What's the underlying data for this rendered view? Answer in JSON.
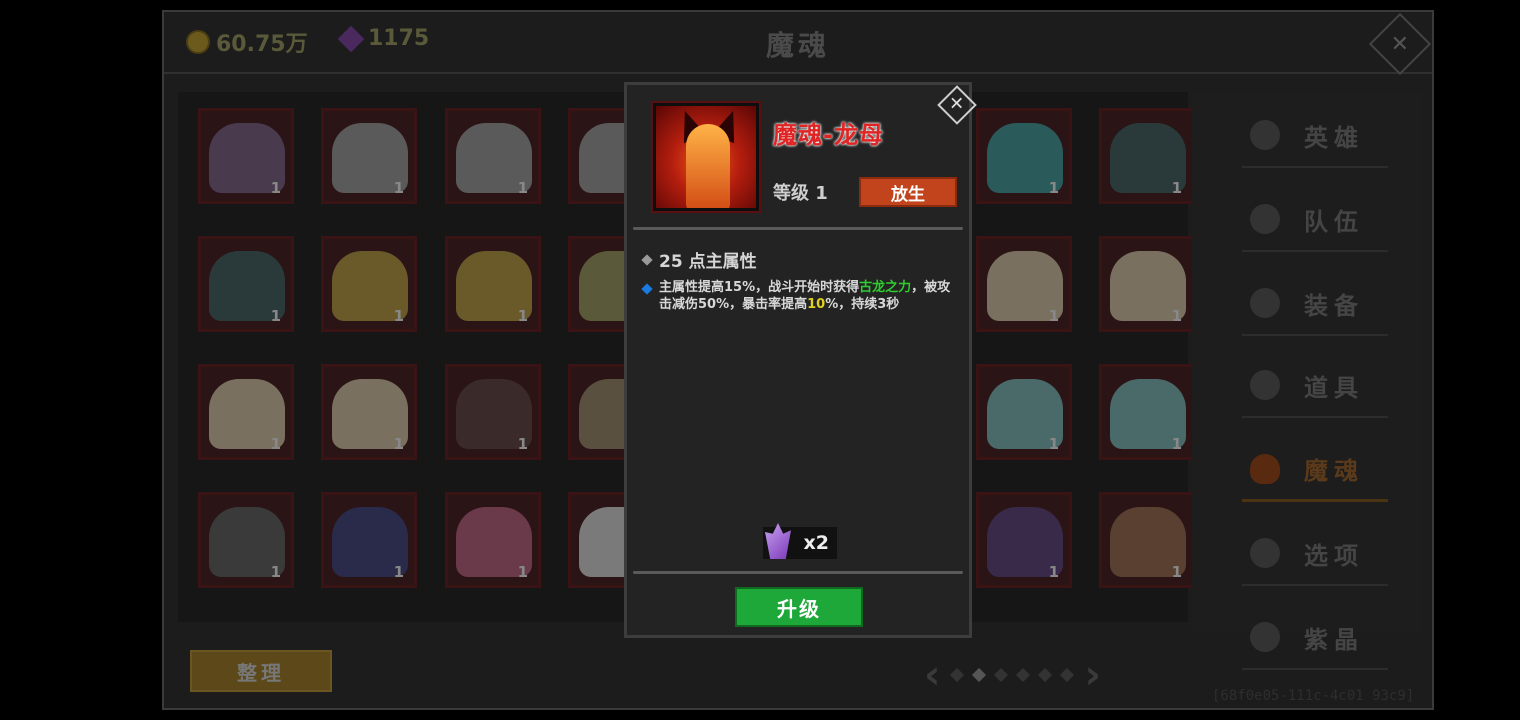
{
  "background": {
    "gold": "60.75万",
    "gems": "1175",
    "title": "魔魂",
    "sort_label": "整理",
    "uid_text": "[68f0e05-111c-4c01 93c9]",
    "tiles": [
      {
        "count": "1",
        "color": "#4a3a4e"
      },
      {
        "count": "1",
        "color": "#5a5a5a"
      },
      {
        "count": "1",
        "color": "#5a5a5a"
      },
      {
        "count": "1",
        "color": "#5a5a5a"
      },
      {
        "count": "1",
        "color": "#2a5a5a"
      },
      {
        "count": "1",
        "color": "#2a3a3a"
      },
      {
        "count": "1",
        "color": "#2a3a3a"
      },
      {
        "count": "1",
        "color": "#6a5a2a"
      },
      {
        "count": "1",
        "color": "#6a5a2a"
      },
      {
        "count": "1",
        "color": "#5a5a3a"
      },
      {
        "count": "1",
        "color": "#7a7060"
      },
      {
        "count": "1",
        "color": "#7a7060"
      },
      {
        "count": "1",
        "color": "#7a7060"
      },
      {
        "count": "1",
        "color": "#7a7060"
      },
      {
        "count": "1",
        "color": "#3a2a2a"
      },
      {
        "count": "1",
        "color": "#5a5040"
      },
      {
        "count": "1",
        "color": "#4a6a6a"
      },
      {
        "count": "1",
        "color": "#4a6a6a"
      },
      {
        "count": "1",
        "color": "#3a3a3a"
      },
      {
        "count": "1",
        "color": "#2a2a4a"
      },
      {
        "count": "1",
        "color": "#6a3a4a"
      },
      {
        "count": "1",
        "color": "#7a7a7a"
      },
      {
        "count": "1",
        "color": "#3a2a4a"
      },
      {
        "count": "1",
        "color": "#5a4030"
      }
    ],
    "menu": [
      {
        "label": "英雄",
        "icon": "heroes-icon",
        "active": false
      },
      {
        "label": "队伍",
        "icon": "flag-icon",
        "active": false
      },
      {
        "label": "装备",
        "icon": "helmet-icon",
        "active": false
      },
      {
        "label": "道具",
        "icon": "bag-icon",
        "active": false
      },
      {
        "label": "魔魂",
        "icon": "flame-icon",
        "active": true
      },
      {
        "label": "选项",
        "icon": "gear-icon",
        "active": false
      },
      {
        "label": "紫晶",
        "icon": "amethyst-icon",
        "active": false
      }
    ]
  },
  "dialog": {
    "name": "魔魂-龙母",
    "level": "等级 1",
    "release_label": "放生",
    "main_attr": "25 点主属性",
    "skill": {
      "p1": "主属性提高15%，战斗开始时获得",
      "h1": "古龙之力",
      "p2": "，被攻击减伤50%，暴击率提高",
      "h2": "10",
      "p3": "%，持续3秒"
    },
    "cost_qty": "x2",
    "upgrade_label": "升级",
    "colors": {
      "name": "#e02424",
      "highlight_green": "#2ecc2e",
      "highlight_yellow": "#e0d020",
      "upgrade": "#1ea83a",
      "release": "#c2441c"
    }
  }
}
